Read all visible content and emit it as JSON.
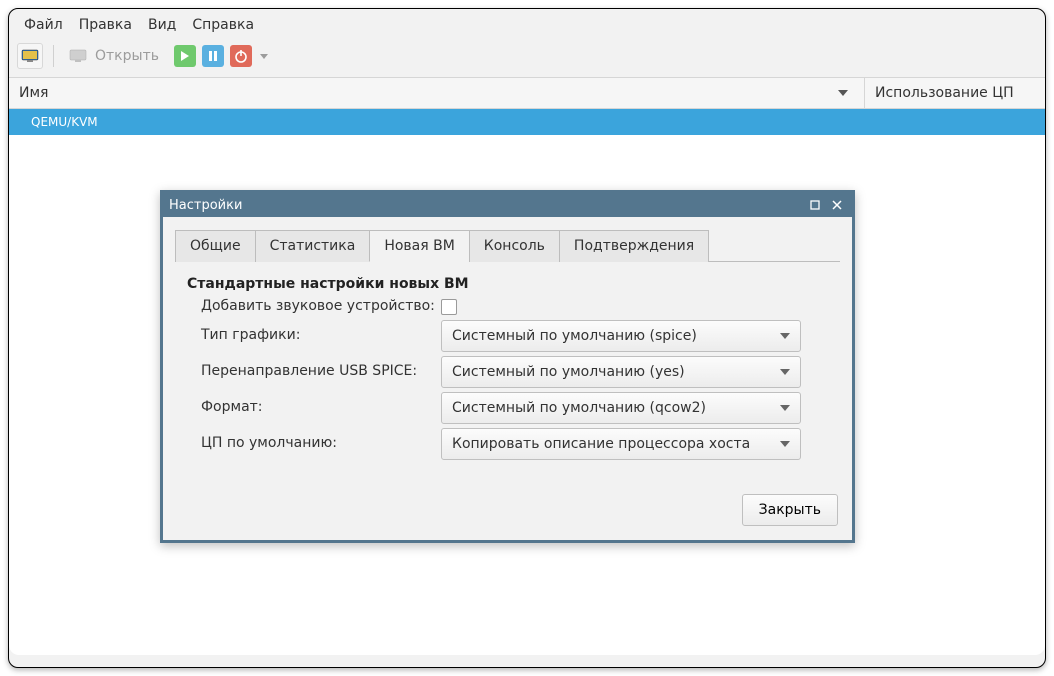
{
  "menubar": {
    "file": "Файл",
    "edit": "Правка",
    "view": "Вид",
    "help": "Справка"
  },
  "toolbar": {
    "open": "Открыть"
  },
  "columns": {
    "name": "Имя",
    "cpu": "Использование ЦП"
  },
  "connection": {
    "label": "QEMU/KVM"
  },
  "dialog": {
    "title": "Настройки",
    "tabs": {
      "general": "Общие",
      "stats": "Статистика",
      "newvm": "Новая ВМ",
      "console": "Консоль",
      "confirm": "Подтверждения"
    },
    "newvm": {
      "section": "Стандартные настройки новых ВМ",
      "add_sound": "Добавить звуковое устройство:",
      "graphics_label": "Тип графики:",
      "graphics_value": "Системный по умолчанию (spice)",
      "usb_label": "Перенаправление USB SPICE:",
      "usb_value": "Системный по умолчанию (yes)",
      "format_label": "Формат:",
      "format_value": "Системный по умолчанию (qcow2)",
      "cpu_label": "ЦП по умолчанию:",
      "cpu_value": "Копировать описание процессора хоста"
    },
    "close": "Закрыть"
  }
}
